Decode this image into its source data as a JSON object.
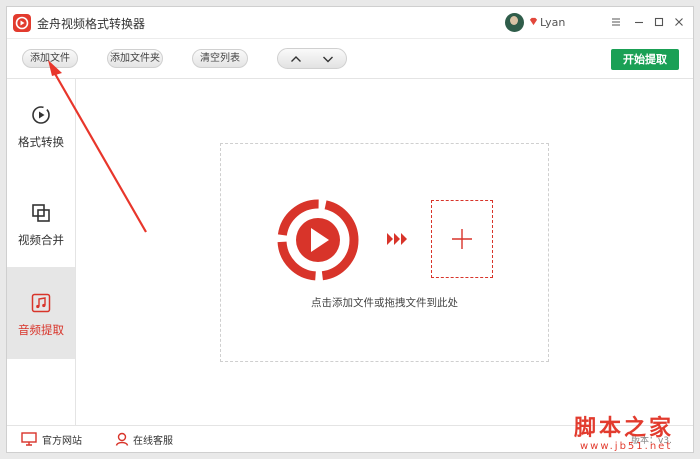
{
  "window": {
    "title": "金舟视频格式转换器"
  },
  "user": {
    "name": "Lyan"
  },
  "toolbar": {
    "add_file": "添加文件",
    "add_folder": "添加文件夹",
    "clear_list": "清空列表",
    "start": "开始提取"
  },
  "sidebar": {
    "items": [
      {
        "label": "格式转换",
        "icon": "play-circle-icon",
        "active": false
      },
      {
        "label": "视频合并",
        "icon": "merge-squares-icon",
        "active": false
      },
      {
        "label": "音频提取",
        "icon": "music-note-icon",
        "active": true
      }
    ]
  },
  "dropzone": {
    "hint": "点击添加文件或拖拽文件到此处"
  },
  "footer": {
    "website": "官方网站",
    "support": "在线客服",
    "version": "版本：v3."
  },
  "watermark": {
    "brand": "脚本之家",
    "url": "www.jb51.net"
  },
  "colors": {
    "accent_red": "#d8342a",
    "start_green": "#1aa055",
    "active_bg": "#e6e6e6"
  }
}
